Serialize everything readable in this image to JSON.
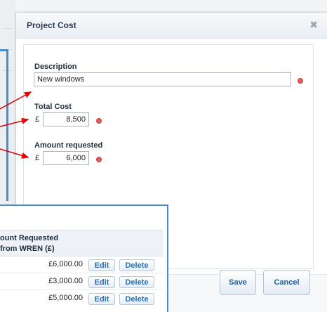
{
  "dialog": {
    "title": "Project Cost",
    "close_icon": "close-icon",
    "description_label": "Description",
    "description_value": "New windows",
    "total_cost_label": "Total Cost",
    "total_cost_currency": "£",
    "total_cost_value": "8,500",
    "amount_requested_label": "Amount requested",
    "amount_requested_currency": "£",
    "amount_requested_value": "6,000",
    "save_label": "Save",
    "cancel_label": "Cancel"
  },
  "table": {
    "header_line1": "ount Requested",
    "header_line2": "from WREN (£)",
    "rows": [
      {
        "amount": "£6,000.00",
        "edit": "Edit",
        "delete": "Delete"
      },
      {
        "amount": "£3,000.00",
        "edit": "Edit",
        "delete": "Delete"
      },
      {
        "amount": "£5,000.00",
        "edit": "Edit",
        "delete": "Delete"
      }
    ]
  },
  "colors": {
    "accent_border": "#4a8ad0",
    "arrow_red": "#e00000",
    "required_dot": "#e85a5a"
  }
}
